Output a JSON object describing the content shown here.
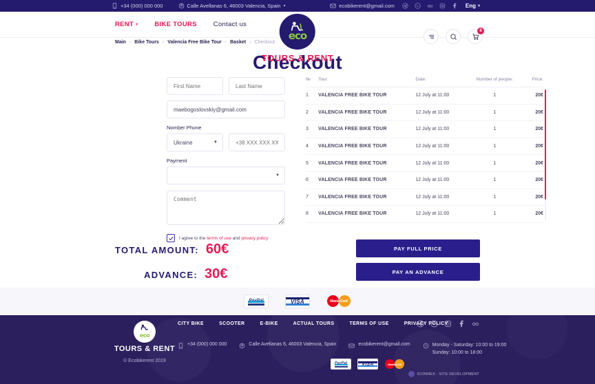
{
  "topbar": {
    "phone": "+34 (000) 000 000",
    "address": "Calle Avellanas 6, 46003 Valencia, Spain",
    "email": "ecobikerent@gmail.com",
    "language": "Eng",
    "social": [
      "telegram-icon",
      "whatsapp-icon",
      "tripadvisor-icon",
      "instagram-icon",
      "facebook-icon"
    ]
  },
  "header": {
    "nav": [
      {
        "label": "RENT",
        "has_caret": true
      },
      {
        "label": "BIKE TOURS",
        "has_caret": false
      },
      {
        "label": "Contact us",
        "has_caret": false
      }
    ],
    "logo_eco": "eco",
    "logo_text": "TOURS & RENT",
    "cart_count": "8"
  },
  "breadcrumb": [
    "Main",
    "Bike Tours",
    "Valencia Free Bike Tour",
    "Basket",
    "Checkout"
  ],
  "page_title": "Checkout",
  "form": {
    "first_name_placeholder": "First Name",
    "last_name_placeholder": "Last Name",
    "email_value": "maebogoslovskiy@gmail.com",
    "phone_label": "Nomber Phone",
    "country_value": "Ukraine",
    "phone_placeholder": "+38 XXX XXX XX XX",
    "payment_label": "Payment",
    "payment_value": "",
    "comment_placeholder": "Comment",
    "agree_prefix": "I agree to the ",
    "agree_terms": "terms of use",
    "agree_and": " and ",
    "agree_privacy": "privacy policy"
  },
  "table": {
    "headers": [
      "№",
      "Tour",
      "Date:",
      "Number of people:",
      "Price:"
    ],
    "rows": [
      {
        "num": "1",
        "tour": "VALENCIA FREE BIKE TOUR",
        "date": "12 July at 11:00",
        "people": "1",
        "price": "20€"
      },
      {
        "num": "2",
        "tour": "VALENCIA FREE BIKE TOUR",
        "date": "12 July at 11:00",
        "people": "1",
        "price": "20€"
      },
      {
        "num": "3",
        "tour": "VALENCIA FREE BIKE TOUR",
        "date": "12 July at 11:00",
        "people": "1",
        "price": "20€"
      },
      {
        "num": "4",
        "tour": "VALENCIA FREE BIKE TOUR",
        "date": "12 July at 11:00",
        "people": "1",
        "price": "20€"
      },
      {
        "num": "5",
        "tour": "VALENCIA FREE BIKE TOUR",
        "date": "12 July at 11:00",
        "people": "1",
        "price": "20€"
      },
      {
        "num": "6",
        "tour": "VALENCIA FREE BIKE TOUR",
        "date": "12 July at 11:00",
        "people": "1",
        "price": "20€"
      },
      {
        "num": "7",
        "tour": "VALENCIA FREE BIKE TOUR",
        "date": "12 July at 11:00",
        "people": "1",
        "price": "20€"
      },
      {
        "num": "8",
        "tour": "VALENCIA FREE BIKE TOUR",
        "date": "12 July at 11:00",
        "people": "1",
        "price": "20€"
      }
    ]
  },
  "totals": {
    "total_label": "TOTAL AMOUNT:",
    "total_value": "60€",
    "advance_label": "ADVANCE:",
    "advance_value": "30€",
    "pay_full_label": "PAY FULL PRICE",
    "pay_advance_label": "PAY AN ADVANCE"
  },
  "payment_logos": [
    "PayPal",
    "VISA",
    "MasterCard"
  ],
  "footer": {
    "logo_eco": "eco",
    "brand": "TOURS & RENT",
    "copyright": "© Ecobikerent 2019",
    "nav": [
      "CITY BIKE",
      "SCOOTER",
      "E-BIKE",
      "ACTUAL TOURS",
      "TERMS OF USE",
      "PRIVACY POLICY"
    ],
    "phone": "+34 (000) 000 000",
    "address": "Calle Avellanas 6, 46003 Valencia, Spain",
    "email": "ecobikerent@gmail.com",
    "hours_weekday": "Monday - Saturday: 10:00 to 19:00",
    "hours_sunday": "Sunday: 10:00 to 18:00",
    "developer": "ICONNEX - SITE DEVELOPMENT",
    "social": [
      "telegram-icon",
      "whatsapp-icon",
      "instagram-icon",
      "facebook-icon",
      "tripadvisor-icon"
    ]
  },
  "colors": {
    "brand_pink": "#e31b54",
    "brand_navy": "#241a6e",
    "footer_bg": "#2b1f5e",
    "eco_green": "#8cc63f"
  }
}
